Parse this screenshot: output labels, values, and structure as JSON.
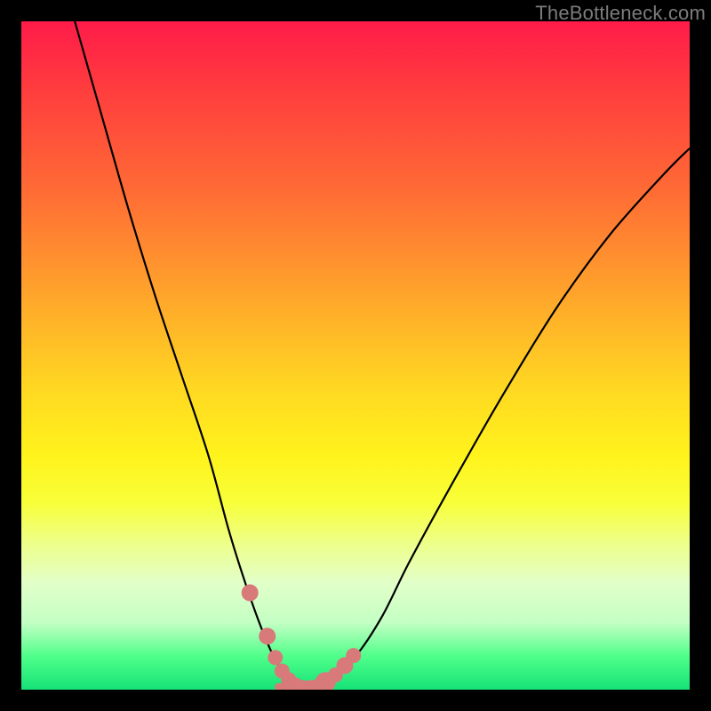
{
  "watermark": "TheBottleneck.com",
  "colors": {
    "frame": "#000000",
    "curve": "#000000",
    "marker": "#d87a7a",
    "gradient_top": "#ff1b49",
    "gradient_mid": "#fff31c",
    "gradient_bottom": "#16e277"
  },
  "chart_data": {
    "type": "line",
    "title": "",
    "xlabel": "",
    "ylabel": "",
    "xlim": [
      0,
      100
    ],
    "ylim": [
      0,
      100
    ],
    "series": [
      {
        "name": "bottleneck-curve",
        "x": [
          8,
          12,
          16,
          20,
          24,
          28,
          31,
          33.5,
          36,
          38,
          40,
          42,
          44,
          46,
          50,
          54,
          58,
          64,
          72,
          80,
          88,
          96,
          100
        ],
        "y": [
          100,
          86,
          72,
          59,
          47,
          35,
          24,
          16,
          9,
          4.5,
          1.5,
          0.3,
          0.3,
          1.5,
          5,
          11,
          19,
          30,
          44,
          57,
          68,
          77,
          81
        ]
      }
    ],
    "markers": {
      "name": "highlighted-points",
      "x": [
        34.2,
        36.8,
        38.0,
        39.0,
        40.0,
        41.0,
        42.0,
        43.0,
        44.0,
        45.5,
        47.0,
        48.4,
        49.7
      ],
      "y": [
        14.5,
        8.0,
        4.8,
        2.8,
        1.5,
        0.7,
        0.3,
        0.3,
        0.4,
        1.1,
        2.2,
        3.6,
        5.1
      ],
      "r": [
        9,
        9,
        8,
        8,
        8,
        8,
        8,
        8,
        8,
        11,
        8,
        9,
        8
      ]
    },
    "flat_segment": {
      "x0": 38.5,
      "x1": 45.0,
      "y": 0.4
    }
  }
}
